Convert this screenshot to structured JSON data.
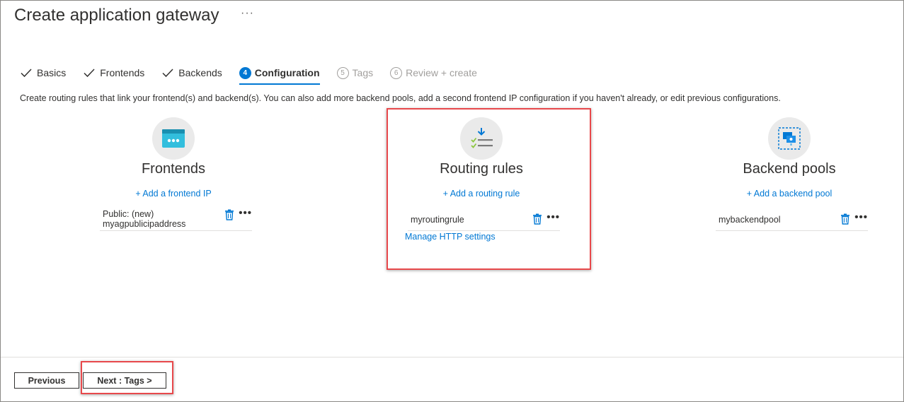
{
  "header": {
    "title": "Create application gateway",
    "more": "···"
  },
  "tabs": [
    {
      "label": "Basics",
      "state": "done"
    },
    {
      "label": "Frontends",
      "state": "done"
    },
    {
      "label": "Backends",
      "state": "done"
    },
    {
      "label": "Configuration",
      "state": "active",
      "number": "4"
    },
    {
      "label": "Tags",
      "state": "disabled",
      "number": "5"
    },
    {
      "label": "Review + create",
      "state": "disabled",
      "number": "6"
    }
  ],
  "description": "Create routing rules that link your frontend(s) and backend(s). You can also add more backend pools, add a second frontend IP configuration if you haven't already, or edit previous configurations.",
  "frontends": {
    "title": "Frontends",
    "icon": "frontend-icon",
    "add_label": "+ Add a frontend IP",
    "item": "Public: (new) myagpublicipaddress"
  },
  "routing": {
    "title": "Routing rules",
    "icon": "routing-rules-icon",
    "add_label": "+ Add a routing rule",
    "item": "myroutingrule",
    "manage_label": "Manage HTTP settings"
  },
  "backends": {
    "title": "Backend pools",
    "icon": "backend-pool-icon",
    "add_label": "+ Add a backend pool",
    "item": "mybackendpool"
  },
  "item_more": "•••",
  "footer": {
    "previous_label": "Previous",
    "next_label": "Next : Tags >"
  },
  "colors": {
    "accent": "#0078d4",
    "highlight": "#e8484b"
  }
}
